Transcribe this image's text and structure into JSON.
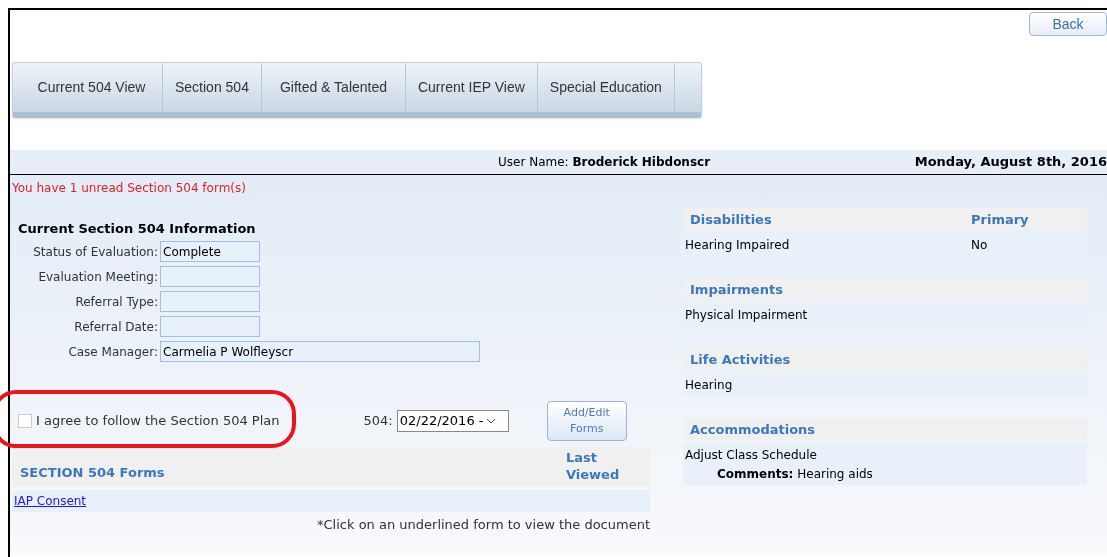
{
  "back_button": "Back",
  "tabs": [
    "Current 504 View",
    "Section 504",
    "Gifted & Talented",
    "Current IEP View",
    "Special Education"
  ],
  "user_bar": {
    "label": "User Name:",
    "user": "Broderick Hibdonscr",
    "date": "Monday, August 8th, 2016"
  },
  "notice": "You have 1 unread Section 504 form(s)",
  "info": {
    "title": "Current Section 504 Information",
    "fields": [
      {
        "label": "Status of Evaluation:",
        "value": "Complete"
      },
      {
        "label": "Evaluation Meeting:"
      },
      {
        "label": "Referral Type:"
      },
      {
        "label": "Referral Date:"
      },
      {
        "label": "Case Manager:",
        "value": "Carmelia P Wolfleyscr"
      }
    ]
  },
  "agreement": {
    "label": "I agree to follow the Section 504 Plan",
    "checked": false,
    "annotated": true
  },
  "plan_select": {
    "label": "504:",
    "value": "02/22/2016 -"
  },
  "add_edit_button": "Add/Edit Forms",
  "forms_table": {
    "columns": [
      "SECTION 504 Forms",
      "Last Viewed"
    ],
    "rows": [
      {
        "form": "IAP Consent"
      }
    ]
  },
  "footnote": "*Click on an underlined form to view the document",
  "sections": [
    {
      "title": "Disabilities",
      "column_2": "Primary",
      "rows": [
        [
          "Hearing Impaired",
          "No"
        ]
      ]
    },
    {
      "title": "Impairments",
      "rows": [
        [
          "Physical Impairment"
        ]
      ]
    },
    {
      "title": "Life Activities",
      "rows": [
        [
          "Hearing"
        ]
      ]
    },
    {
      "title": "Accommodations",
      "rows": [
        [
          "Adjust Class Schedule"
        ]
      ],
      "comment": "**Comments:** Hearing aids"
    }
  ]
}
